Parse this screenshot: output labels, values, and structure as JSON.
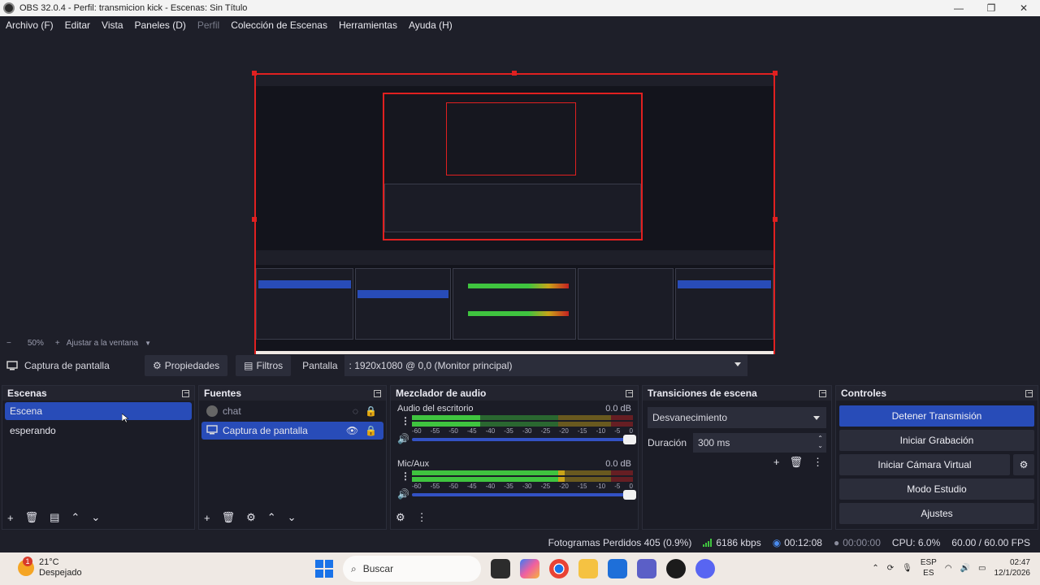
{
  "window": {
    "title": "OBS 32.0.4 - Perfil: transmicion kick - Escenas: Sin Título",
    "minimize": "—",
    "maximize": "❐",
    "close": "✕"
  },
  "menu": [
    "Archivo (F)",
    "Editar",
    "Vista",
    "Paneles (D)",
    "Perfil",
    "Colección de Escenas",
    "Herramientas",
    "Ayuda (H)"
  ],
  "zoom": {
    "minus": "−",
    "level": "50%",
    "plus": "+",
    "fit_label": "Ajustar a la ventana"
  },
  "source_toolbar": {
    "source_name": "Captura de pantalla",
    "properties": "Propiedades",
    "filters": "Filtros",
    "screen_label": "Pantalla",
    "screen_value": ": 1920x1080 @ 0,0 (Monitor principal)"
  },
  "scenes": {
    "title": "Escenas",
    "items": [
      {
        "label": "Escena",
        "selected": true
      },
      {
        "label": "esperando",
        "selected": false
      }
    ]
  },
  "sources": {
    "title": "Fuentes",
    "items": [
      {
        "label": "chat",
        "visible": false
      },
      {
        "label": "Captura de pantalla",
        "visible": true
      }
    ]
  },
  "audio": {
    "title": "Mezclador de audio",
    "tracks": [
      {
        "name": "Audio del escritorio",
        "db": "0.0 dB",
        "level": 0.31
      },
      {
        "name": "Mic/Aux",
        "db": "0.0 dB",
        "level": 0.69
      }
    ],
    "scale": [
      "-60",
      "-55",
      "-50",
      "-45",
      "-40",
      "-35",
      "-30",
      "-25",
      "-20",
      "-15",
      "-10",
      "-5",
      "0"
    ]
  },
  "transitions": {
    "title": "Transiciones de escena",
    "selected": "Desvanecimiento",
    "duration_label": "Duración",
    "duration_value": "300 ms"
  },
  "controls": {
    "title": "Controles",
    "buttons": [
      "Detener Transmisión",
      "Iniciar Grabación",
      "Iniciar Cámara Virtual",
      "Modo Estudio",
      "Ajustes"
    ]
  },
  "status": {
    "dropped": "Fotogramas Perdidos 405 (0.9%)",
    "bitrate": "6186 kbps",
    "stream_time": "00:12:08",
    "rec_time": "00:00:00",
    "cpu": "CPU: 6.0%",
    "fps": "60.00 / 60.00 FPS"
  },
  "taskbar": {
    "weather_badge": "1",
    "temp": "21°C",
    "condition": "Despejado",
    "search": "Buscar",
    "lang1": "ESP",
    "lang2": "ES",
    "time": "02:47",
    "date": "12/1/2026"
  },
  "colors": {
    "accent": "#284cb8",
    "meter_green": "#3fc43f",
    "meter_yellow": "#c9a418",
    "meter_red": "#c42121"
  }
}
